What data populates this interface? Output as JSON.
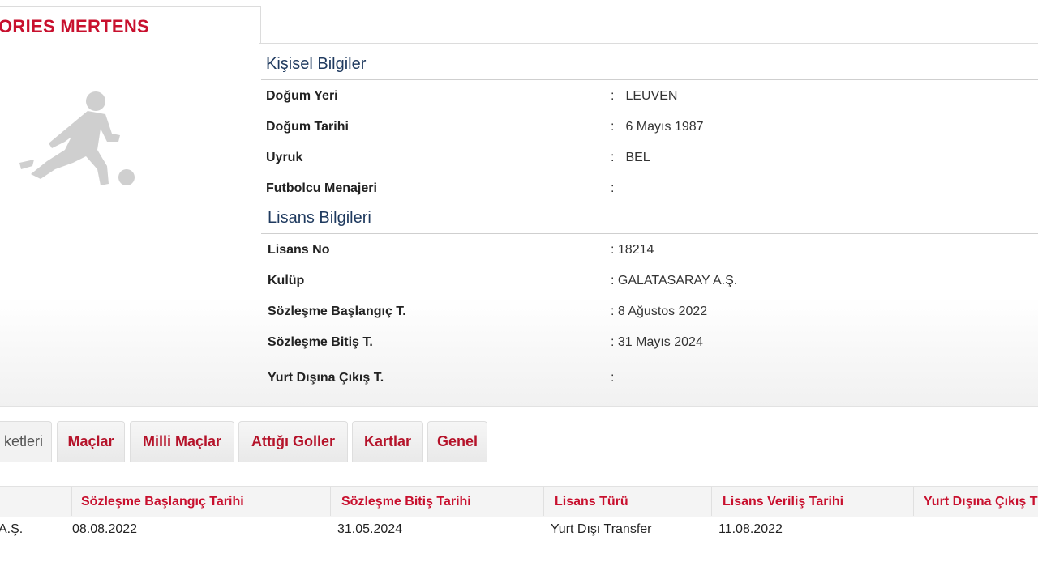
{
  "player": {
    "name": "ORIES MERTENS"
  },
  "personal": {
    "title": "Kişisel Bilgiler",
    "rows": [
      {
        "label": "Doğum Yeri",
        "value": "LEUVEN"
      },
      {
        "label": "Doğum Tarihi",
        "value": "6 Mayıs 1987"
      },
      {
        "label": "Uyruk",
        "value": "BEL"
      },
      {
        "label": "Futbolcu Menajeri",
        "value": ""
      }
    ]
  },
  "license": {
    "title": "Lisans Bilgileri",
    "rows": [
      {
        "label": "Lisans No",
        "value": "18214"
      },
      {
        "label": "Kulüp",
        "value": "GALATASARAY A.Ş."
      },
      {
        "label": "Sözleşme Başlangıç T.",
        "value": "8 Ağustos 2022"
      },
      {
        "label": "Sözleşme Bitiş T.",
        "value": "31 Mayıs 2024"
      },
      {
        "label": "Yurt Dışına Çıkış T.",
        "value": ""
      }
    ]
  },
  "tabs": [
    {
      "label": "ketleri",
      "active": true
    },
    {
      "label": "Maçlar"
    },
    {
      "label": "Milli Maçlar"
    },
    {
      "label": "Attığı Goller"
    },
    {
      "label": "Kartlar"
    },
    {
      "label": "Genel"
    }
  ],
  "table": {
    "headers": [
      "",
      "Sözleşme Başlangıç Tarihi",
      "Sözleşme Bitiş Tarihi",
      "Lisans Türü",
      "Lisans Veriliş Tarihi",
      "Yurt Dışına Çıkış T"
    ],
    "rows": [
      [
        "A.Ş.",
        "08.08.2022",
        "31.05.2024",
        "Yurt Dışı Transfer",
        "11.08.2022",
        ""
      ]
    ]
  },
  "colors": {
    "accent": "#c8102e",
    "section": "#1f3a5f"
  },
  "icons": {
    "player_silhouette": "player-silhouette-icon"
  }
}
